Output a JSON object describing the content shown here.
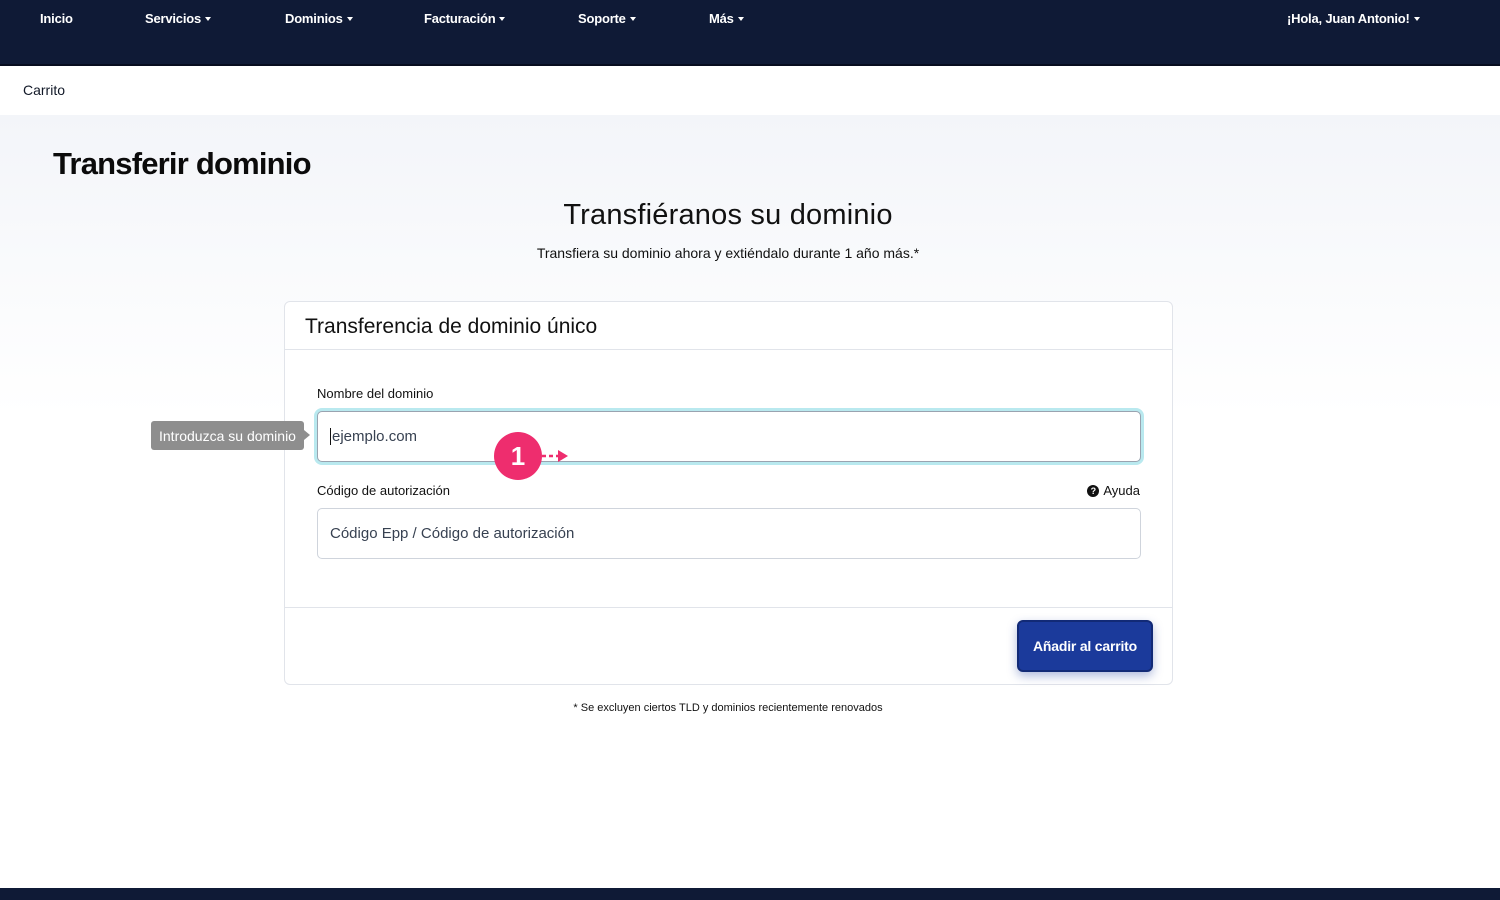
{
  "nav": {
    "items": [
      {
        "label": "Inicio",
        "dropdown": false
      },
      {
        "label": "Servicios",
        "dropdown": true
      },
      {
        "label": "Dominios",
        "dropdown": true
      },
      {
        "label": "Facturación",
        "dropdown": true
      },
      {
        "label": "Soporte",
        "dropdown": true
      },
      {
        "label": "Más",
        "dropdown": true
      }
    ],
    "user_greeting": "¡Hola, Juan Antonio!"
  },
  "breadcrumb": "Carrito",
  "page_title": "Transferir dominio",
  "hero": {
    "title": "Transfiéranos su dominio",
    "subtitle": "Transfiera su dominio ahora y extiéndalo durante 1 año más.*"
  },
  "card": {
    "title": "Transferencia de dominio único",
    "domain_label": "Nombre del dominio",
    "domain_placeholder": "ejemplo.com",
    "auth_label": "Código de autorización",
    "auth_placeholder": "Código Epp / Código de autorización",
    "help_label": "Ayuda",
    "add_button": "Añadir al carrito"
  },
  "footnote": "* Se excluyen ciertos TLD y dominios recientemente renovados",
  "tooltip": "Introduzca su dominio",
  "annotation": {
    "step": "1"
  },
  "colors": {
    "nav_bg": "#0f1a36",
    "button_bg": "#1b3a9b",
    "focus_ring": "#b9e9ef",
    "annotation": "#ee2d6e"
  }
}
